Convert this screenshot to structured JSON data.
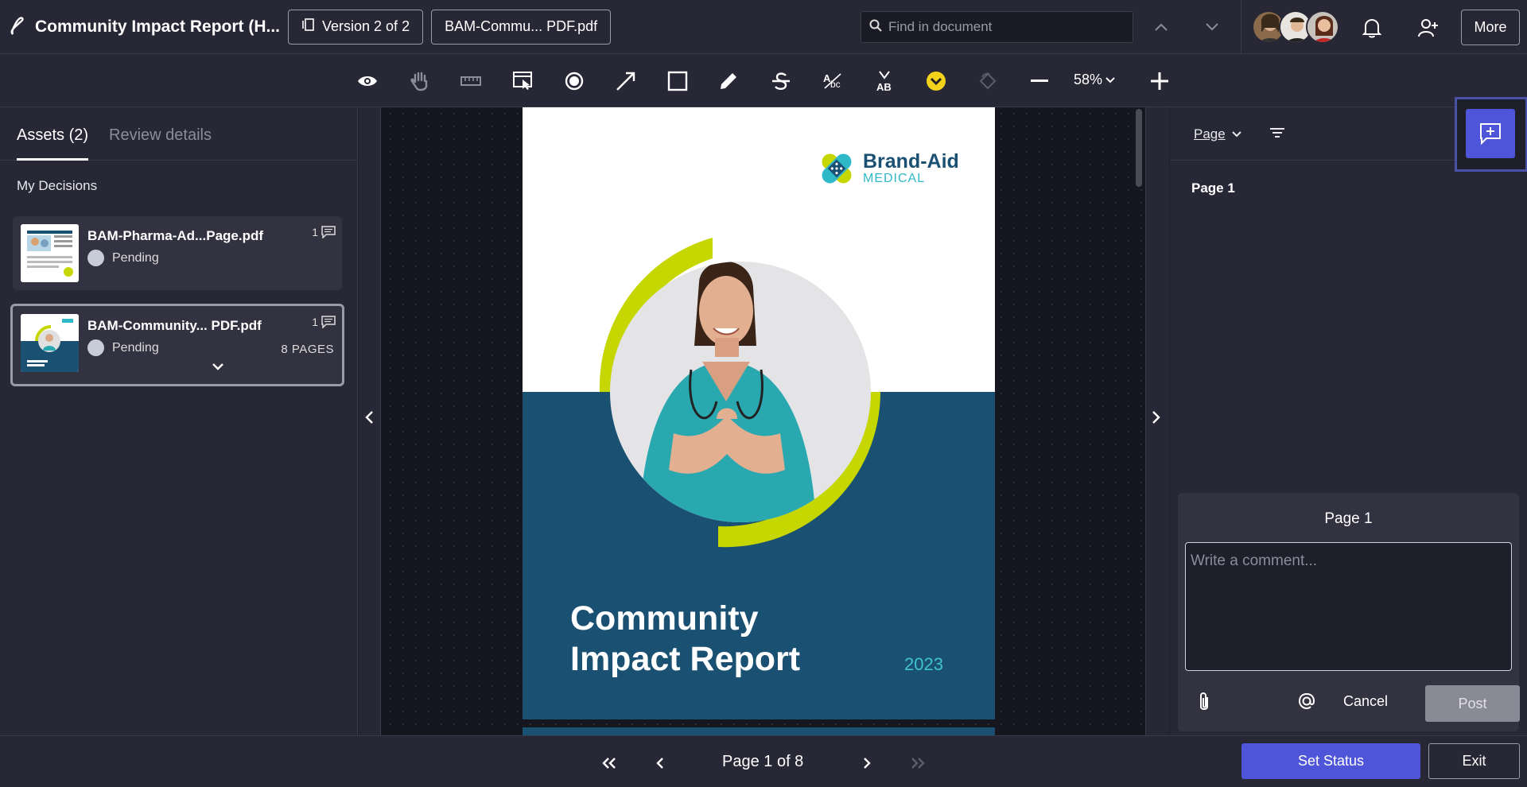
{
  "header": {
    "title": "Community Impact Report (H...",
    "version_label": "Version 2 of 2",
    "file_label": "BAM-Commu... PDF.pdf",
    "search_placeholder": "Find in document",
    "more_label": "More"
  },
  "toolbar": {
    "tools": [
      "eye-icon",
      "hand-icon",
      "ruler-icon",
      "select-area-icon",
      "circle-icon",
      "arrow-icon",
      "rectangle-icon",
      "pencil-icon",
      "strikethrough-icon",
      "replace-text-icon",
      "insert-text-icon",
      "approve-icon",
      "rotate-icon"
    ],
    "zoom": "58%"
  },
  "left_panel": {
    "tabs": [
      {
        "label": "Assets (2)",
        "active": true
      },
      {
        "label": "Review details",
        "active": false
      }
    ],
    "section_title": "My Decisions",
    "assets": [
      {
        "name": "BAM-Pharma-Ad...Page.pdf",
        "status": "Pending",
        "comments": "1",
        "pages": ""
      },
      {
        "name": "BAM-Community... PDF.pdf",
        "status": "Pending",
        "comments": "1",
        "pages": "8 PAGES"
      }
    ]
  },
  "document": {
    "brand_name": "Brand-Aid",
    "brand_sub": "MEDICAL",
    "title_line1": "Community",
    "title_line2": "Impact Report",
    "year": "2023"
  },
  "right_panel": {
    "filter_label": "Page",
    "page_group": "Page 1",
    "comment_box": {
      "title": "Page 1",
      "placeholder": "Write a comment...",
      "cancel_label": "Cancel",
      "post_label": "Post"
    }
  },
  "footer": {
    "page_indicator": "Page 1 of 8",
    "set_status_label": "Set Status",
    "exit_label": "Exit"
  },
  "colors": {
    "accent": "#4f55d9",
    "navy": "#1a5072",
    "lime": "#c5d600",
    "teal": "#2fb8c8",
    "approve": "#f2d21b"
  }
}
